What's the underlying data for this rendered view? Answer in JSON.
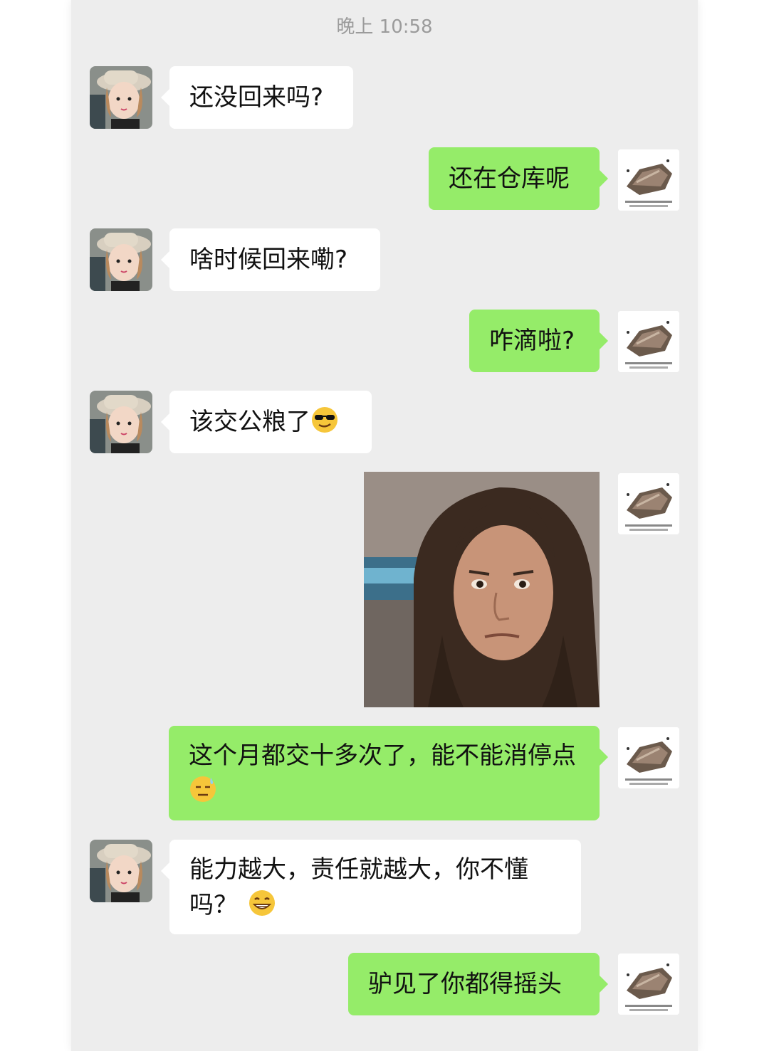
{
  "header": {
    "time": "晚上 10:58"
  },
  "contacts": {
    "left_avatar_icon": "girl-in-hat-avatar",
    "right_avatar_icon": "rock-illustration-avatar"
  },
  "messages": [
    {
      "side": "left",
      "type": "text",
      "text": "还没回来吗?"
    },
    {
      "side": "right",
      "type": "text",
      "text": "还在仓库呢"
    },
    {
      "side": "left",
      "type": "text",
      "text": "啥时候回来嘞?"
    },
    {
      "side": "right",
      "type": "text",
      "text": "咋滴啦?"
    },
    {
      "side": "left",
      "type": "text",
      "text": "该交公粮了",
      "emoji": "cool-sunglasses-emoji"
    },
    {
      "side": "right",
      "type": "sticker",
      "sticker": "long-hair-man-reaction-sticker"
    },
    {
      "side": "right",
      "type": "text",
      "text": "这个月都交十多次了，能不能消停点",
      "emoji": "sweat-emoji"
    },
    {
      "side": "left",
      "type": "text",
      "text": "能力越大，责任就越大，你不懂吗？",
      "emoji": "grin-emoji"
    },
    {
      "side": "right",
      "type": "text",
      "text": "驴见了你都得摇头"
    }
  ],
  "colors": {
    "background": "#ededed",
    "incoming_bubble": "#ffffff",
    "outgoing_bubble": "#95ec69",
    "timestamp": "#9b9b9b"
  }
}
